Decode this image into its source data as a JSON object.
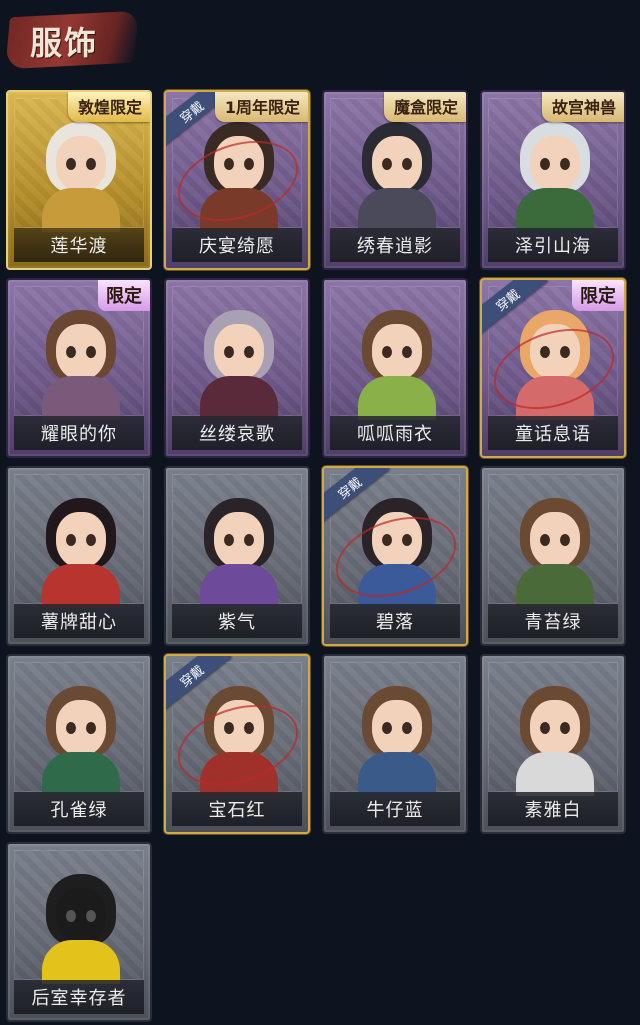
{
  "header": {
    "title": "服饰"
  },
  "icons": {
    "worn": "worn-badge",
    "limited": "limited-badge"
  },
  "colors": {
    "background": "#0d1420",
    "gold": "#d9b850",
    "purple": "#8c76a7",
    "gray": "#7a808b",
    "worn_tag": "#3d4f78"
  },
  "costumes": [
    {
      "name": "莲华渡",
      "tier": "gold",
      "tag": "敦煌限定",
      "worn_label": ""
    },
    {
      "name": "庆宴绮愿",
      "tier": "purple",
      "tag": "1周年限定",
      "worn_label": "穿戴"
    },
    {
      "name": "绣春逍影",
      "tier": "purple",
      "tag": "魔盒限定",
      "worn_label": ""
    },
    {
      "name": "泽引山海",
      "tier": "purple",
      "tag": "故宫神兽",
      "worn_label": ""
    },
    {
      "name": "耀眼的你",
      "tier": "purple",
      "tag": "限定",
      "worn_label": ""
    },
    {
      "name": "丝缕哀歌",
      "tier": "purple",
      "tag": "",
      "worn_label": ""
    },
    {
      "name": "呱呱雨衣",
      "tier": "purple",
      "tag": "",
      "worn_label": ""
    },
    {
      "name": "童话息语",
      "tier": "purple",
      "tag": "限定",
      "worn_label": "穿戴"
    },
    {
      "name": "薯牌甜心",
      "tier": "gray",
      "tag": "",
      "worn_label": ""
    },
    {
      "name": "紫气",
      "tier": "gray",
      "tag": "",
      "worn_label": ""
    },
    {
      "name": "碧落",
      "tier": "gray",
      "tag": "",
      "worn_label": "穿戴"
    },
    {
      "name": "青苔绿",
      "tier": "gray",
      "tag": "",
      "worn_label": ""
    },
    {
      "name": "孔雀绿",
      "tier": "gray",
      "tag": "",
      "worn_label": ""
    },
    {
      "name": "宝石红",
      "tier": "gray",
      "tag": "",
      "worn_label": "穿戴"
    },
    {
      "name": "牛仔蓝",
      "tier": "gray",
      "tag": "",
      "worn_label": ""
    },
    {
      "name": "素雅白",
      "tier": "gray",
      "tag": "",
      "worn_label": ""
    },
    {
      "name": "后室幸存者",
      "tier": "gray",
      "tag": "",
      "worn_label": ""
    }
  ]
}
